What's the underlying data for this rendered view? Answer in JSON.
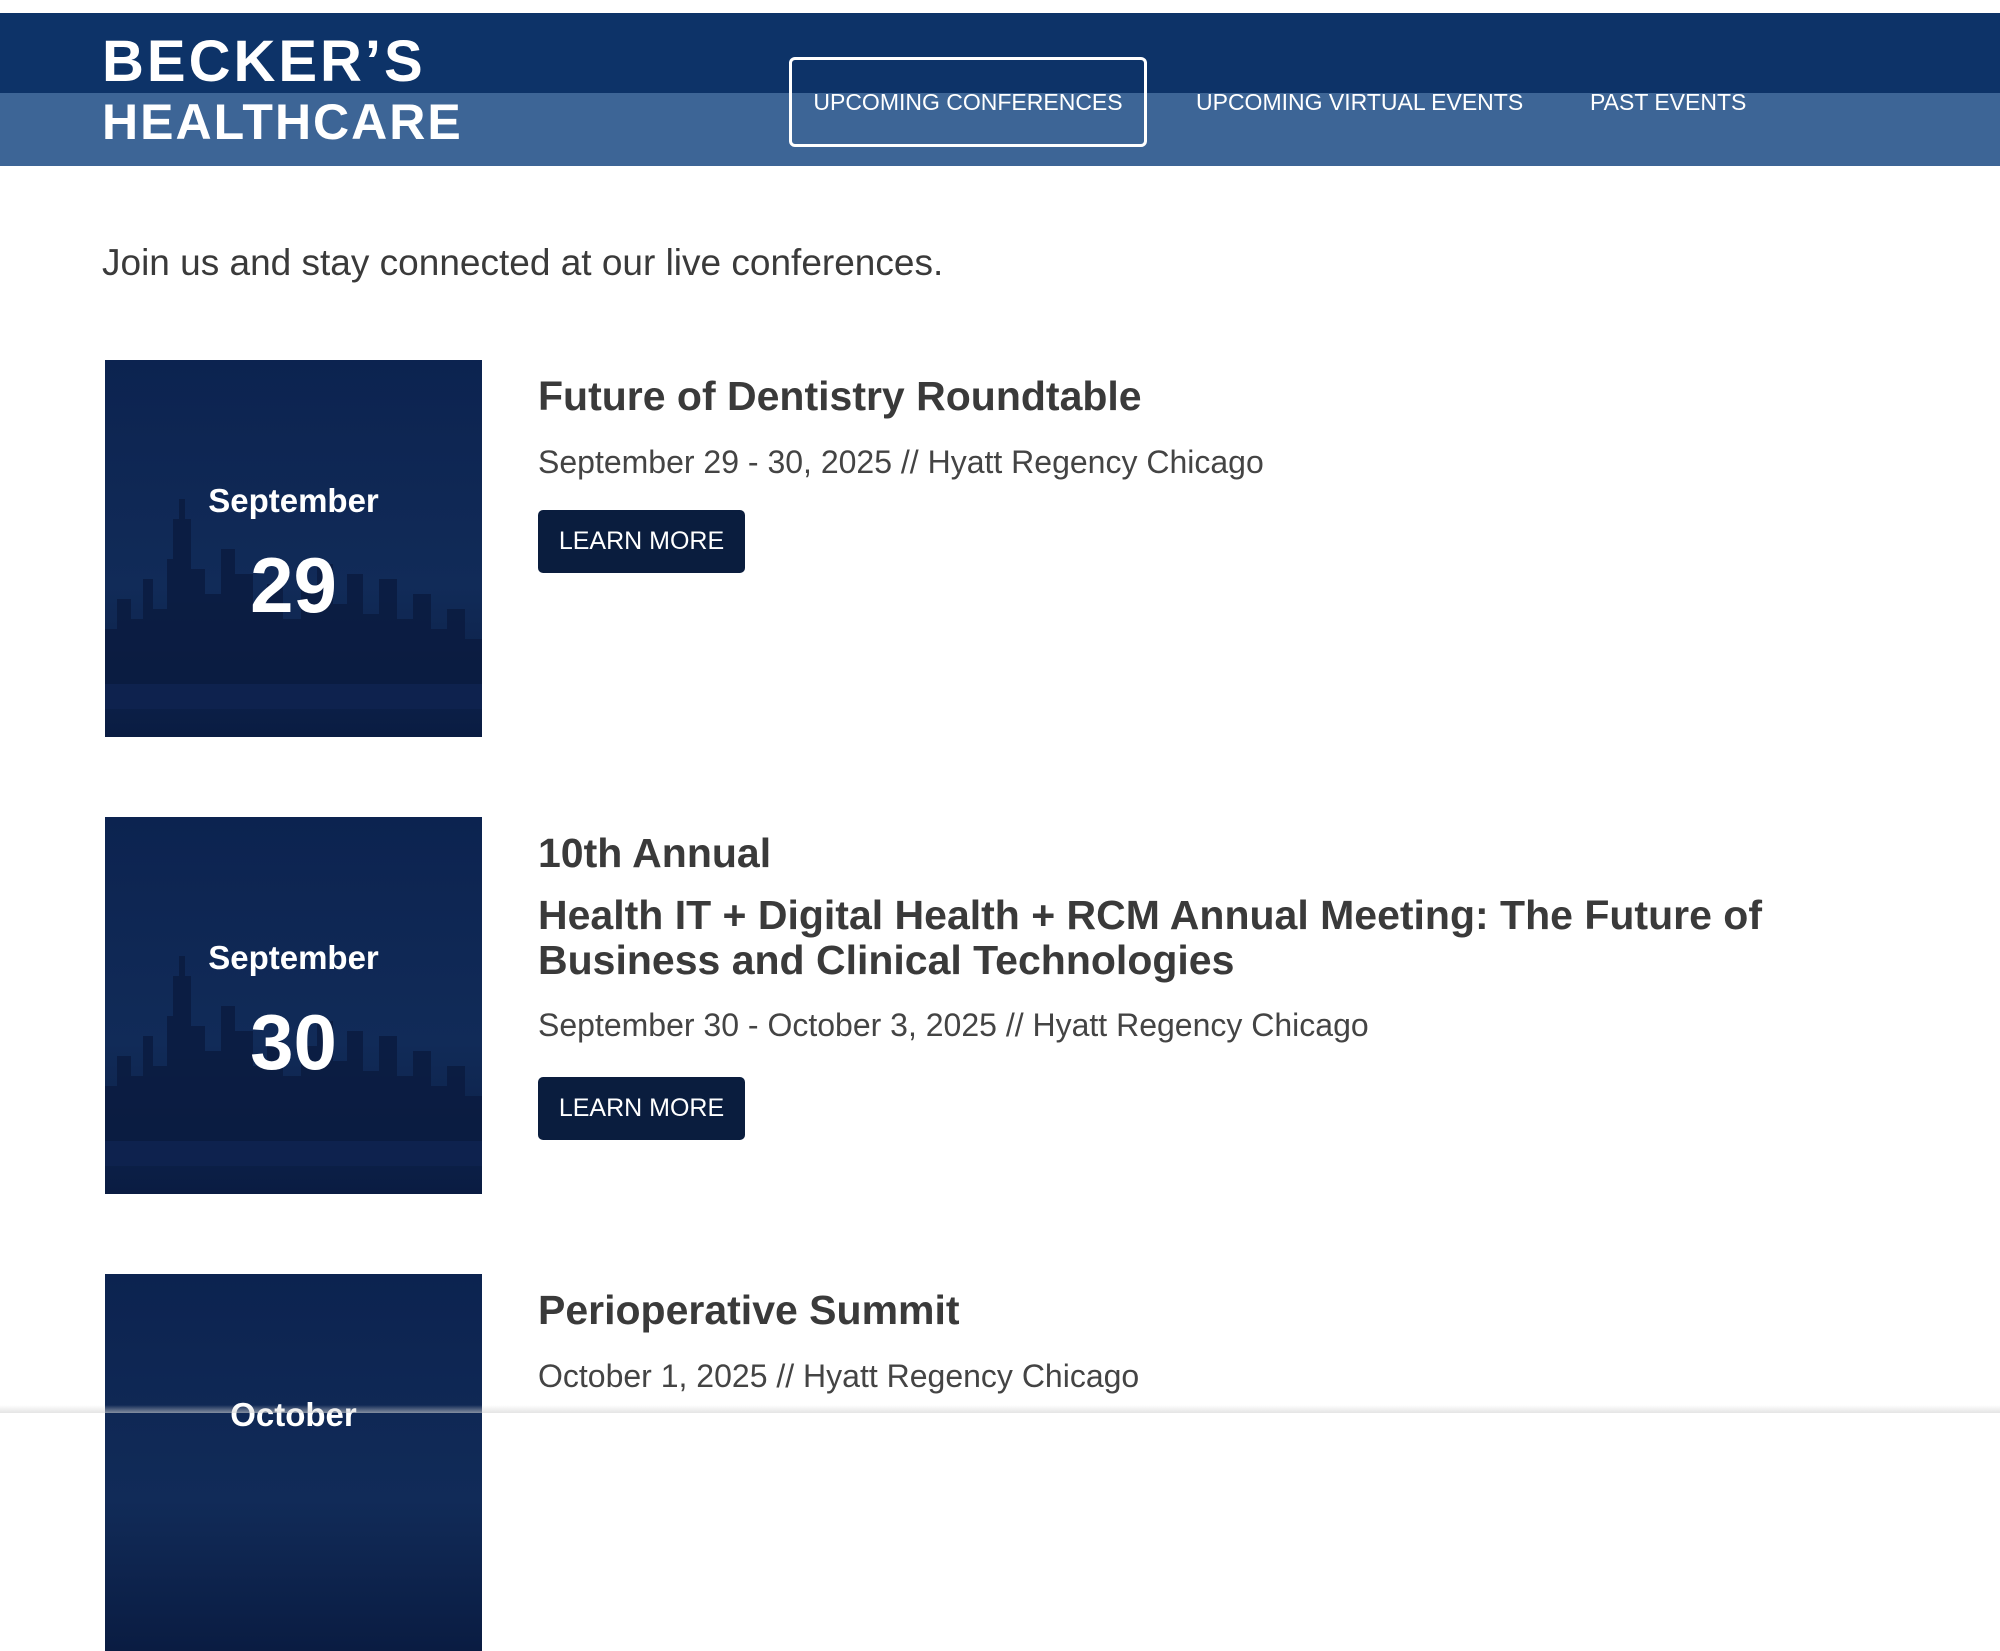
{
  "header": {
    "logo_line1": "BECKER’S",
    "logo_line2": "HEALTHCARE",
    "nav": [
      {
        "label": "UPCOMING CONFERENCES",
        "active": true
      },
      {
        "label": "UPCOMING VIRTUAL EVENTS",
        "active": false
      },
      {
        "label": "PAST EVENTS",
        "active": false
      }
    ]
  },
  "intro": "Join us and stay connected at our live conferences.",
  "events": [
    {
      "month": "September",
      "day": "29",
      "title": "Future of Dentistry Roundtable",
      "subtitle": "",
      "meta": "September 29 - 30, 2025 // Hyatt Regency Chicago",
      "button": "LEARN MORE"
    },
    {
      "month": "September",
      "day": "30",
      "title": "10th Annual",
      "subtitle": "Health IT + Digital Health + RCM Annual Meeting: The Future of Business and Clinical Technologies",
      "meta": "September 30 - October 3, 2025 // Hyatt Regency Chicago",
      "button": "LEARN MORE"
    },
    {
      "month": "October",
      "day": "",
      "title": "Perioperative Summit",
      "subtitle": "",
      "meta": "October 1, 2025 // Hyatt Regency Chicago",
      "button": ""
    }
  ],
  "colors": {
    "header_dark": "#0d3368",
    "header_light": "#3d6596",
    "tile_bg": "#0c2350",
    "button_bg": "#0a1d3e",
    "text": "#3a3a3a"
  }
}
